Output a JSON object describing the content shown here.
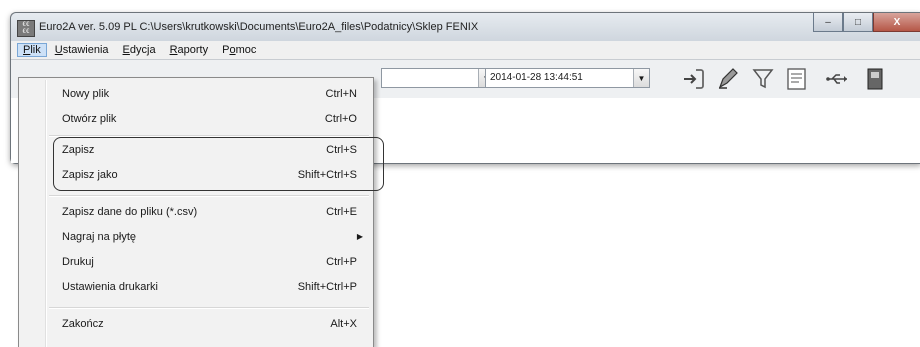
{
  "window": {
    "title": "Euro2A ver. 5.09 PL   C:\\Users\\krutkowski\\Documents\\Euro2A_files\\Podatnicy\\Sklep FENIX",
    "icon": "euro2a-app-icon",
    "controls": {
      "minimize": "–",
      "maximize": "□",
      "close": "X"
    }
  },
  "menubar": {
    "items": [
      {
        "label": "Plik",
        "mnemonic": "P",
        "rest": "lik"
      },
      {
        "label": "Ustawienia",
        "mnemonic": "U",
        "rest": "stawienia"
      },
      {
        "label": "Edycja",
        "mnemonic": "E",
        "rest": "dycja"
      },
      {
        "label": "Raporty",
        "mnemonic": "R",
        "rest": "aporty"
      },
      {
        "label": "Pomoc",
        "pre": "P",
        "mnemonic": "o",
        "rest": "moc"
      }
    ]
  },
  "toolbar": {
    "combo1_value": "",
    "datetime_value": "2014-01-28 13:44:51",
    "tools": [
      "import-arrow-icon",
      "edit-pencil-icon",
      "filter-funnel-icon",
      "document-list-icon",
      "usb-icon",
      "book-icon"
    ]
  },
  "file_menu": {
    "items": [
      {
        "label": "Nowy plik",
        "shortcut": "Ctrl+N"
      },
      {
        "label": "Otwórz plik",
        "shortcut": "Ctrl+O"
      },
      {
        "label": "Zapisz",
        "shortcut": "Ctrl+S"
      },
      {
        "label": "Zapisz jako",
        "shortcut": "Shift+Ctrl+S"
      },
      {
        "label": "Zapisz dane do pliku (*.csv)",
        "shortcut": "Ctrl+E"
      },
      {
        "label": "Nagraj na płytę",
        "shortcut": ""
      },
      {
        "label": "Drukuj",
        "shortcut": "Ctrl+P"
      },
      {
        "label": "Ustawienia drukarki",
        "shortcut": "Shift+Ctrl+P"
      },
      {
        "label": "Zakończ",
        "shortcut": "Alt+X"
      }
    ]
  },
  "colors": {
    "menu_highlight": "#cde1f7",
    "close_button": "#b55747"
  }
}
